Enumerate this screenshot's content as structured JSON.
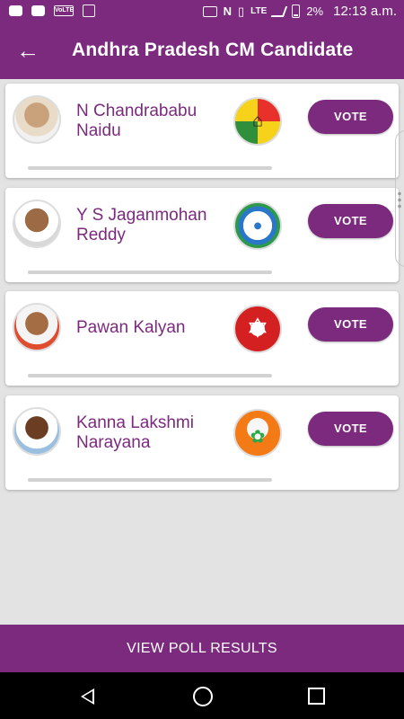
{
  "status_bar": {
    "icons": [
      "video-call-icon",
      "video-icon",
      "volte-icon",
      "document-icon",
      "cast-icon",
      "nfc-icon",
      "vibrate-icon",
      "lte-signal-icon",
      "battery-icon"
    ],
    "volte_label": "VoLTE",
    "network_label": "LTE",
    "battery": "2%",
    "time": "12:13 a.m."
  },
  "app_bar": {
    "title": "Andhra Pradesh CM Candidate",
    "back_icon": "arrow-left-icon"
  },
  "candidates": [
    {
      "name": "N Chandrababu Naidu",
      "vote_label": "VOTE",
      "party_logo": "tdp-logo",
      "vote_share": 0
    },
    {
      "name": "Y S Jaganmohan Reddy",
      "vote_label": "VOTE",
      "party_logo": "ysrcp-logo",
      "vote_share": 0
    },
    {
      "name": "Pawan Kalyan",
      "vote_label": "VOTE",
      "party_logo": "janasena-logo",
      "vote_share": 0
    },
    {
      "name": "Kanna Lakshmi Narayana",
      "vote_label": "VOTE",
      "party_logo": "bjp-logo",
      "vote_share": 0
    }
  ],
  "footer": {
    "view_results_label": "VIEW POLL RESULTS"
  },
  "colors": {
    "primary": "#7b2a7e",
    "background": "#e3e3e3",
    "card": "#ffffff",
    "progress_track": "#d2d2d2"
  }
}
